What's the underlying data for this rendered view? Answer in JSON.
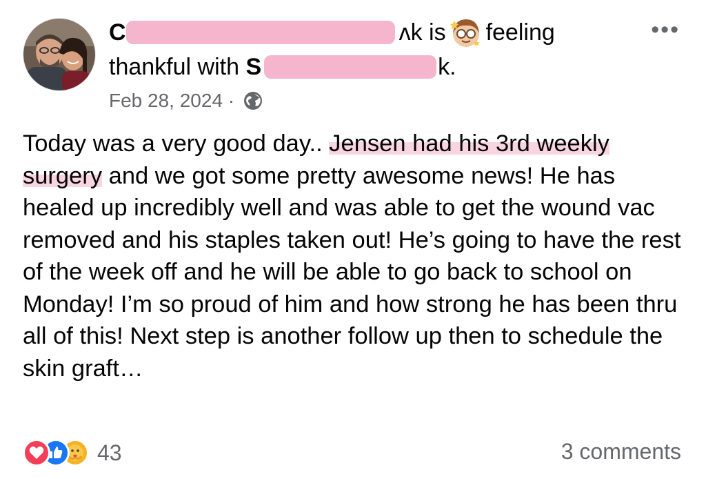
{
  "post": {
    "header": {
      "author_initial": "C",
      "author_suffix": "ᴧk",
      "is_text": "is",
      "feeling_text": "feeling",
      "feeling_word": "thankful with",
      "tagged_initial": "S",
      "tagged_suffix": "k.",
      "date": "Feb 28, 2024 ·"
    },
    "body": {
      "part1": "Today was a very good day.. ",
      "highlight": "Jensen had his  3rd weekly surgery",
      "part2": " and we got some pretty awesome news! He has healed up incredibly well and was able to get the wound vac removed and his staples taken out! He’s going to have the rest of the week off and he will be able to go back to school on Monday! I’m so proud of him and how strong he has been thru all of this! Next step is another follow up then to schedule the skin graft…"
    },
    "footer": {
      "reaction_count": "43",
      "comments_label": "3 comments"
    },
    "icons": {
      "more": "more-icon",
      "privacy": "globe-icon",
      "mood": "thankful-emoji-icon",
      "reactions": [
        "love-icon",
        "like-icon",
        "care-icon"
      ]
    },
    "colors": {
      "redaction": "#f4b2ca",
      "secondary_text": "#65676b",
      "like_blue": "#1877f2",
      "love_red": "#f33e58",
      "care_yellow": "#f7b125"
    }
  }
}
